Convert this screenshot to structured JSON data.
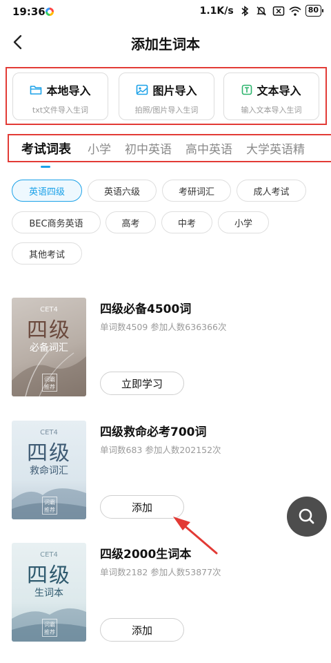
{
  "status_bar": {
    "time": "19:36",
    "network_speed": "1.1K/s",
    "battery": "80"
  },
  "nav": {
    "title": "添加生词本"
  },
  "import_options": [
    {
      "label": "本地导入",
      "sub": "txt文件导入生词",
      "icon": "folder-icon"
    },
    {
      "label": "图片导入",
      "sub": "拍照/图片导入生词",
      "icon": "image-icon"
    },
    {
      "label": "文本导入",
      "sub": "输入文本导入生词",
      "icon": "text-icon"
    }
  ],
  "tabs": [
    "考试词表",
    "小学",
    "初中英语",
    "高中英语",
    "大学英语精"
  ],
  "active_tab": 0,
  "chips": [
    "英语四级",
    "英语六级",
    "考研词汇",
    "成人考试",
    "BEC商务英语",
    "高考",
    "中考",
    "小学",
    "其他考试"
  ],
  "active_chip": 0,
  "books": [
    {
      "name": "四级必备4500词",
      "stats": "单词数4509  参加人数636366次",
      "button": "立即学习",
      "cover": {
        "cet": "CET4",
        "big": "四级",
        "small": "必备词汇",
        "stamp": "词霸推荐"
      }
    },
    {
      "name": "四级救命必考700词",
      "stats": "单词数683  参加人数202152次",
      "button": "添加",
      "cover": {
        "cet": "CET4",
        "big": "四级",
        "small": "救命词汇",
        "stamp": "词霸推荐"
      }
    },
    {
      "name": "四级2000生词本",
      "stats": "单词数2182  参加人数53877次",
      "button": "添加",
      "cover": {
        "cet": "CET4",
        "big": "四级",
        "small": "生词本",
        "stamp": "词霸推荐"
      }
    }
  ],
  "colors": {
    "accent": "#1aa1e8",
    "highlight_box": "#e23a35",
    "fab": "#4d4d4d"
  }
}
